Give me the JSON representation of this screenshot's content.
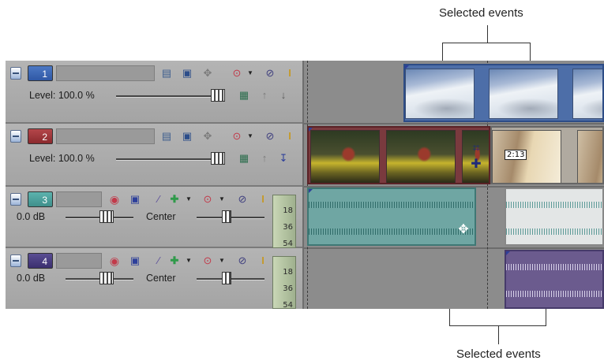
{
  "callouts": {
    "top": "Selected events",
    "bottom": "Selected events"
  },
  "colors": {
    "video_track_1": "#2f58a5",
    "video_track_2": "#8b2a2e",
    "audio_track_3": "#3f8f8b",
    "audio_track_4": "#3b2f6f",
    "audio_event_teal": "#6fa6a3",
    "audio_event_purple": "#6b5b8e"
  },
  "tracks": [
    {
      "number": "1",
      "kind": "video",
      "level_label": "Level: 100.0 %"
    },
    {
      "number": "2",
      "kind": "video",
      "level_label": "Level: 100.0 %"
    },
    {
      "number": "3",
      "kind": "audio",
      "volume_label": "0.0 dB",
      "pan_label": "Center",
      "meter": [
        "18",
        "36",
        "54"
      ]
    },
    {
      "number": "4",
      "kind": "audio",
      "volume_label": "0.0 dB",
      "pan_label": "Center",
      "meter": [
        "18",
        "36",
        "54"
      ]
    }
  ],
  "events": {
    "crossfade_label": "2:13"
  },
  "icons": {
    "compositing": "compositing-mode-icon",
    "track_fx": "track-fx-icon",
    "motion": "track-motion-icon",
    "automation": "automation-settings-icon",
    "mute": "mute-icon",
    "solo": "solo-icon",
    "record_arm": "arm-record-icon",
    "invert_phase": "invert-phase-icon",
    "insert_fx": "insert-fx-icon",
    "expand": "expand-icon"
  }
}
